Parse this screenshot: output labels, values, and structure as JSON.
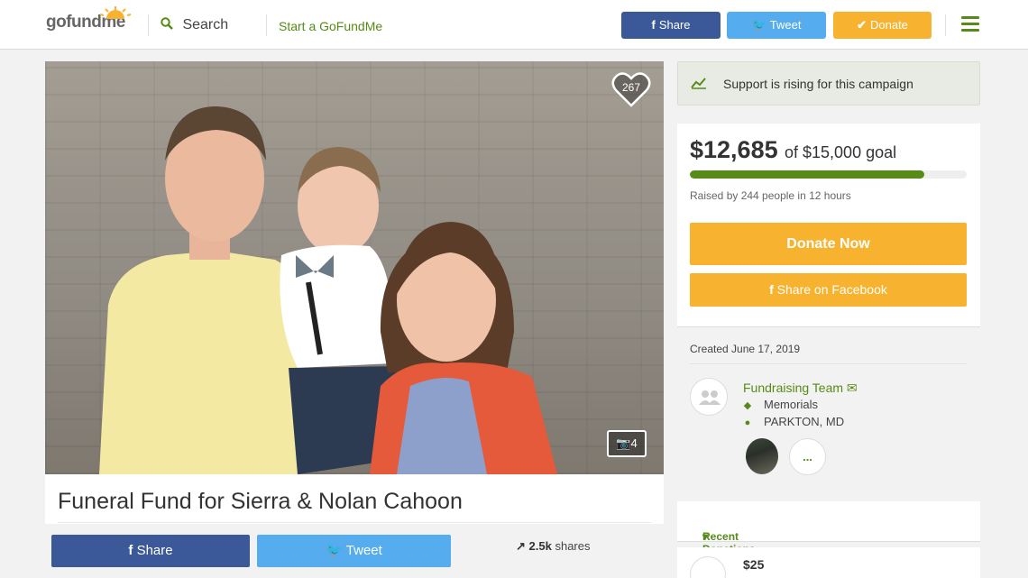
{
  "header": {
    "logo": "gofundme",
    "search_label": "Search",
    "start_label": "Start a GoFundMe",
    "share_label": "Share",
    "tweet_label": "Tweet",
    "donate_label": "Donate",
    "colors": {
      "share": "#3b5998",
      "tweet": "#55acee",
      "donate": "#f7b32f",
      "brand": "#558b16"
    }
  },
  "photo": {
    "hearts": "267",
    "photo_count": "4"
  },
  "campaign": {
    "title": "Funeral Fund for Sierra & Nolan Cahoon",
    "share_label": "Share",
    "tweet_label": "Tweet",
    "shares_count": "2.5k",
    "shares_suffix": "shares"
  },
  "sidebar": {
    "rising_text": "Support is rising for this campaign",
    "raised": "$12,685",
    "goal_text": "of $15,000 goal",
    "progress_fraction": 0.846,
    "raised_by": "Raised by 244 people in 12 hours",
    "donate_now": "Donate Now",
    "share_facebook": "Share on Facebook",
    "created": "Created June 17, 2019",
    "team": {
      "name": "Fundraising Team",
      "category": "Memorials",
      "location": "PARKTON, MD",
      "more": "..."
    },
    "recent_donations_label": "Recent Donations",
    "first_donation": "$25"
  }
}
